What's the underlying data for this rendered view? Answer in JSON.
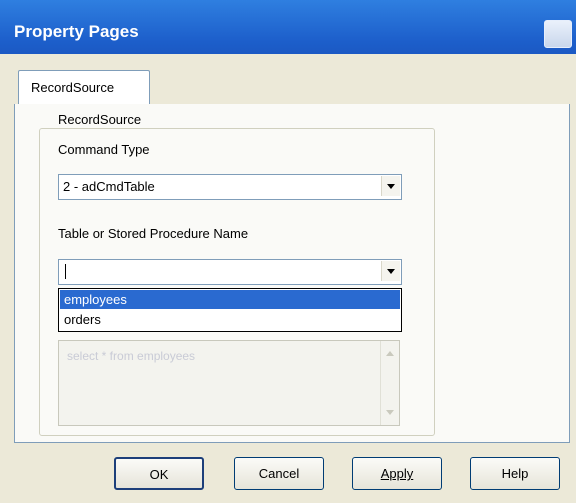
{
  "window": {
    "title": "Property Pages"
  },
  "tabs": [
    {
      "label": "RecordSource"
    }
  ],
  "group": {
    "title": "RecordSource",
    "command_type": {
      "label": "Command Type",
      "value": "2 - adCmdTable"
    },
    "table_proc": {
      "label": "Table or Stored Procedure Name",
      "value": ""
    },
    "dropdown_options": [
      "employees",
      "orders"
    ],
    "selected_option": "employees",
    "command_text_placeholder": "select * from employees"
  },
  "buttons": {
    "ok": "OK",
    "cancel": "Cancel",
    "apply": "Apply",
    "help": "Help"
  },
  "colors": {
    "titlebar": "#1d5fcb",
    "selection": "#2a6ad0",
    "dialog_bg": "#ece9d8"
  }
}
